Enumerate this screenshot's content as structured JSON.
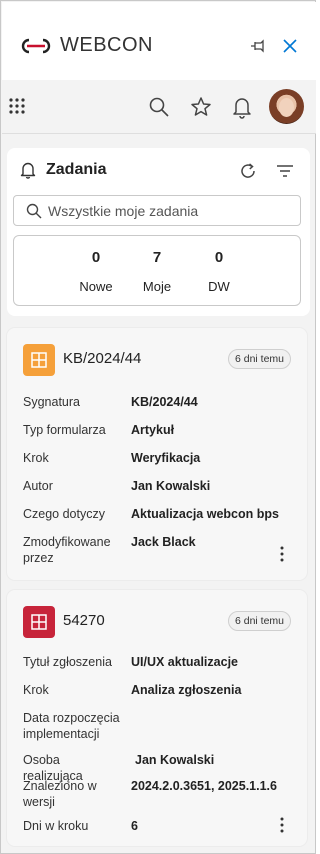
{
  "app": {
    "brand": "WEBCON"
  },
  "colors": {
    "accent": "#0078d4",
    "brand_red": "#c8102e",
    "orange": "#f5a03a",
    "crimson": "#c7243a"
  },
  "icons": {
    "logo": "webcon-logo-icon",
    "pin": "pin-icon",
    "close": "close-icon",
    "grid": "app-launcher-icon",
    "search": "search-icon",
    "star": "star-icon",
    "bell": "bell-icon",
    "refresh": "refresh-icon",
    "filter": "filter-icon",
    "more": "more-vertical-icon"
  },
  "tasks": {
    "title": "Zadania",
    "search_placeholder": "Wszystkie moje zadania",
    "counters": [
      {
        "value": "0",
        "label": "Nowe"
      },
      {
        "value": "7",
        "label": "Moje"
      },
      {
        "value": "0",
        "label": "DW"
      }
    ]
  },
  "cards": [
    {
      "title": "KB/2024/44",
      "time": "6 dni temu",
      "icon_color": "#f5a03a",
      "rows": [
        {
          "label": "Sygnatura",
          "value": "KB/2024/44"
        },
        {
          "label": "Typ formularza",
          "value": "Artykuł"
        },
        {
          "label": "Krok",
          "value": "Weryfikacja"
        },
        {
          "label": "Autor",
          "value": "Jan Kowalski"
        },
        {
          "label": "Czego dotyczy",
          "value": "Aktualizacja webcon bps"
        },
        {
          "label": "Zmodyfikowane przez",
          "value": "Jack Black"
        }
      ]
    },
    {
      "title": "54270",
      "time": "6 dni temu",
      "icon_color": "#c7243a",
      "rows": [
        {
          "label": "Tytuł zgłoszenia",
          "value": "UI/UX aktualizacje"
        },
        {
          "label": "Krok",
          "value": "Analiza zgłoszenia"
        },
        {
          "label": "Data rozpoczęcia implementacji",
          "value": ""
        },
        {
          "label": "Osoba realizująca",
          "value": "Jan Kowalski"
        },
        {
          "label": "Znaleziono w wersji",
          "value": "2024.2.0.3651, 2025.1.1.6"
        },
        {
          "label": "Dni w kroku",
          "value": "6"
        }
      ]
    }
  ]
}
